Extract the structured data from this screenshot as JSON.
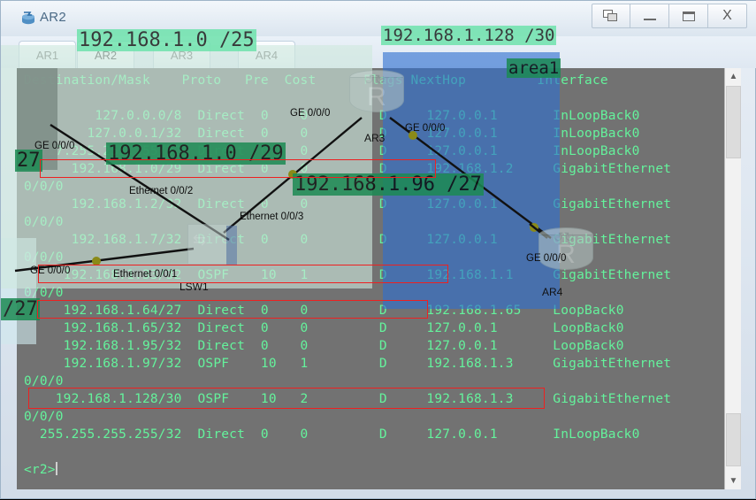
{
  "window": {
    "title": "AR2",
    "icon": "router-app-icon",
    "controls": [
      {
        "name": "restore-button",
        "label": "restore"
      },
      {
        "name": "minimize-button",
        "label": "minimize"
      },
      {
        "name": "maximize-button",
        "label": "maximize"
      },
      {
        "name": "close-button",
        "label": "X"
      }
    ]
  },
  "tabs": [
    {
      "label": "AR1",
      "active": false
    },
    {
      "label": "AR2",
      "active": true
    },
    {
      "label": "AR3",
      "active": false
    },
    {
      "label": "AR4",
      "active": false
    }
  ],
  "terminal": {
    "header": "Destination/Mask    Proto   Pre  Cost      Flags NextHop         Interface",
    "columns": [
      "Destination/Mask",
      "Proto",
      "Pre",
      "Cost",
      "Flags",
      "NextHop",
      "Interface"
    ],
    "routes": [
      {
        "dest": "127.0.0.0/8",
        "proto": "Direct",
        "pre": "0",
        "cost": "0",
        "flags": "D",
        "nexthop": "127.0.0.1",
        "interface": "InLoopBack0",
        "wrap": ""
      },
      {
        "dest": "127.0.0.1/32",
        "proto": "Direct",
        "pre": "0",
        "cost": "0",
        "flags": "D",
        "nexthop": "127.0.0.1",
        "interface": "InLoopBack0",
        "wrap": ""
      },
      {
        "dest": "127.255.255.255/32",
        "proto": "Direct",
        "pre": "0",
        "cost": "0",
        "flags": "D",
        "nexthop": "127.0.0.1",
        "interface": "InLoopBack0",
        "wrap": ""
      },
      {
        "dest": "192.168.1.0/29",
        "proto": "Direct",
        "pre": "0",
        "cost": "0",
        "flags": "D",
        "nexthop": "192.168.1.2",
        "interface": "GigabitEthernet",
        "wrap": "0/0/0"
      },
      {
        "dest": "192.168.1.2/32",
        "proto": "Direct",
        "pre": "0",
        "cost": "0",
        "flags": "D",
        "nexthop": "127.0.0.1",
        "interface": "GigabitEthernet",
        "wrap": "0/0/0"
      },
      {
        "dest": "192.168.1.7/32",
        "proto": "Direct",
        "pre": "0",
        "cost": "0",
        "flags": "D",
        "nexthop": "127.0.0.1",
        "interface": "GigabitEthernet",
        "wrap": "0/0/0"
      },
      {
        "dest": "192.168.1.33/32",
        "proto": "OSPF",
        "pre": "10",
        "cost": "1",
        "flags": "D",
        "nexthop": "192.168.1.1",
        "interface": "GigabitEthernet",
        "wrap": "0/0/0"
      },
      {
        "dest": "192.168.1.64/27",
        "proto": "Direct",
        "pre": "0",
        "cost": "0",
        "flags": "D",
        "nexthop": "192.168.1.65",
        "interface": "LoopBack0",
        "wrap": ""
      },
      {
        "dest": "192.168.1.65/32",
        "proto": "Direct",
        "pre": "0",
        "cost": "0",
        "flags": "D",
        "nexthop": "127.0.0.1",
        "interface": "LoopBack0",
        "wrap": ""
      },
      {
        "dest": "192.168.1.95/32",
        "proto": "Direct",
        "pre": "0",
        "cost": "0",
        "flags": "D",
        "nexthop": "127.0.0.1",
        "interface": "LoopBack0",
        "wrap": ""
      },
      {
        "dest": "192.168.1.97/32",
        "proto": "OSPF",
        "pre": "10",
        "cost": "1",
        "flags": "D",
        "nexthop": "192.168.1.3",
        "interface": "GigabitEthernet",
        "wrap": "0/0/0"
      },
      {
        "dest": "192.168.1.128/30",
        "proto": "OSPF",
        "pre": "10",
        "cost": "2",
        "flags": "D",
        "nexthop": "192.168.1.3",
        "interface": "GigabitEthernet",
        "wrap": "0/0/0"
      },
      {
        "dest": "255.255.255.255/32",
        "proto": "Direct",
        "pre": "0",
        "cost": "0",
        "flags": "D",
        "nexthop": "127.0.0.1",
        "interface": "InLoopBack0",
        "wrap": ""
      }
    ],
    "prompt": "<r2>"
  },
  "topology": {
    "nodes": [
      {
        "name": "AR3",
        "label": "AR3"
      },
      {
        "name": "AR4",
        "label": "AR4"
      },
      {
        "name": "LSW1",
        "label": "LSW1"
      }
    ],
    "interface_labels": [
      {
        "label": "GE 0/0/0"
      },
      {
        "label": "GE 0/0/0"
      },
      {
        "label": "GE 0/0/0"
      },
      {
        "label": "GE 0/0/0"
      },
      {
        "label": "GE 0/0/0"
      },
      {
        "label": "Ethernet 0/0/2"
      },
      {
        "label": "Ethernet 0/0/3"
      },
      {
        "label": "Ethernet 0/0/1"
      }
    ]
  },
  "annotations": [
    {
      "name": "subnet-label-1",
      "text": "192.168.1.0 /25"
    },
    {
      "name": "subnet-label-2",
      "text": "192.168.1.128 /30"
    },
    {
      "name": "subnet-label-3",
      "text": "192.168.1.0 /29"
    },
    {
      "name": "subnet-label-4",
      "text": "192.168.1.96 /27"
    },
    {
      "name": "subnet-label-5",
      "text": "27"
    },
    {
      "name": "subnet-label-6",
      "text": "/27"
    },
    {
      "name": "area-label",
      "text": "area1"
    }
  ],
  "colors": {
    "terminal_text": "#64f39c",
    "terminal_bg": "#727272",
    "highlight_green": "#6fe3ad",
    "highlight_dark_green": "#1c8a53",
    "zone_blue": "#2f6fd0",
    "annotation_red": "#ee2020"
  }
}
